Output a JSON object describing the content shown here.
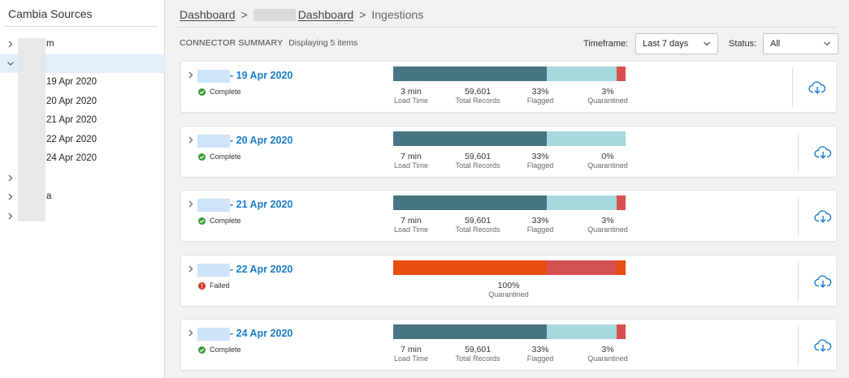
{
  "sidebar": {
    "title": "Cambia Sources",
    "items": [
      {
        "chevron": ">",
        "label": "m",
        "selected": false
      },
      {
        "chevron": "v",
        "label": "",
        "selected": true
      },
      {
        "chevron": "",
        "label": "19 Apr 2020",
        "selected": false
      },
      {
        "chevron": "",
        "label": "20 Apr 2020",
        "selected": false
      },
      {
        "chevron": "",
        "label": "21 Apr 2020",
        "selected": false
      },
      {
        "chevron": "",
        "label": "22 Apr 2020",
        "selected": false
      },
      {
        "chevron": "",
        "label": "24 Apr 2020",
        "selected": false
      },
      {
        "chevron": ">",
        "label": "",
        "selected": false
      },
      {
        "chevron": ">",
        "label": "a",
        "selected": false
      },
      {
        "chevron": ">",
        "label": "",
        "selected": false
      }
    ]
  },
  "breadcrumb": {
    "dashboard": "Dashboard",
    "sep1": ">",
    "sub_dashboard": "Dashboard",
    "sep2": ">",
    "current": "Ingestions"
  },
  "summary": {
    "title": "CONNECTOR SUMMARY",
    "count_text": "Displaying 5 items"
  },
  "filters": {
    "timeframe_label": "Timeframe:",
    "timeframe_value": "Last 7 days",
    "status_label": "Status:",
    "status_value": "All"
  },
  "colors": {
    "load": "#477582",
    "flagged": "#a6d9dd",
    "quarantined": "#d94f50",
    "failed_main": "#e64d0e",
    "failed_mid": "#d5514f",
    "link": "#1a7bd0",
    "success": "#3a9a37",
    "error": "#d53a1c"
  },
  "cards": [
    {
      "title": "- 19 Apr 2020",
      "status": "Complete",
      "state": "ok",
      "bar": [
        66,
        30,
        4
      ],
      "metrics": [
        {
          "value": "3 min",
          "label": "Load Time"
        },
        {
          "value": "59,601",
          "label": "Total Records"
        },
        {
          "value": "33%",
          "label": "Flagged"
        },
        {
          "value": "3%",
          "label": "Quarantined"
        }
      ]
    },
    {
      "title": "- 20 Apr 2020",
      "status": "Complete",
      "state": "ok",
      "bar": [
        66,
        34,
        0
      ],
      "metrics": [
        {
          "value": "7 min",
          "label": "Load Time"
        },
        {
          "value": "59,601",
          "label": "Total Records"
        },
        {
          "value": "33%",
          "label": "Flagged"
        },
        {
          "value": "0%",
          "label": "Quarantined"
        }
      ]
    },
    {
      "title": "- 21 Apr 2020",
      "status": "Complete",
      "state": "ok",
      "bar": [
        66,
        30,
        4
      ],
      "metrics": [
        {
          "value": "7 min",
          "label": "Load Time"
        },
        {
          "value": "59,601",
          "label": "Total Records"
        },
        {
          "value": "33%",
          "label": "Flagged"
        },
        {
          "value": "3%",
          "label": "Quarantined"
        }
      ]
    },
    {
      "title": "- 22 Apr 2020",
      "status": "Failed",
      "state": "fail",
      "bar": [
        66,
        30,
        4
      ],
      "metrics": [
        {
          "value": "100%",
          "label": "Quarantined"
        }
      ]
    },
    {
      "title": "- 24 Apr 2020",
      "status": "Complete",
      "state": "ok",
      "bar": [
        66,
        30,
        4
      ],
      "metrics": [
        {
          "value": "7 min",
          "label": "Load Time"
        },
        {
          "value": "59,601",
          "label": "Total Records"
        },
        {
          "value": "33%",
          "label": "Flagged"
        },
        {
          "value": "3%",
          "label": "Quarantined"
        }
      ]
    }
  ]
}
